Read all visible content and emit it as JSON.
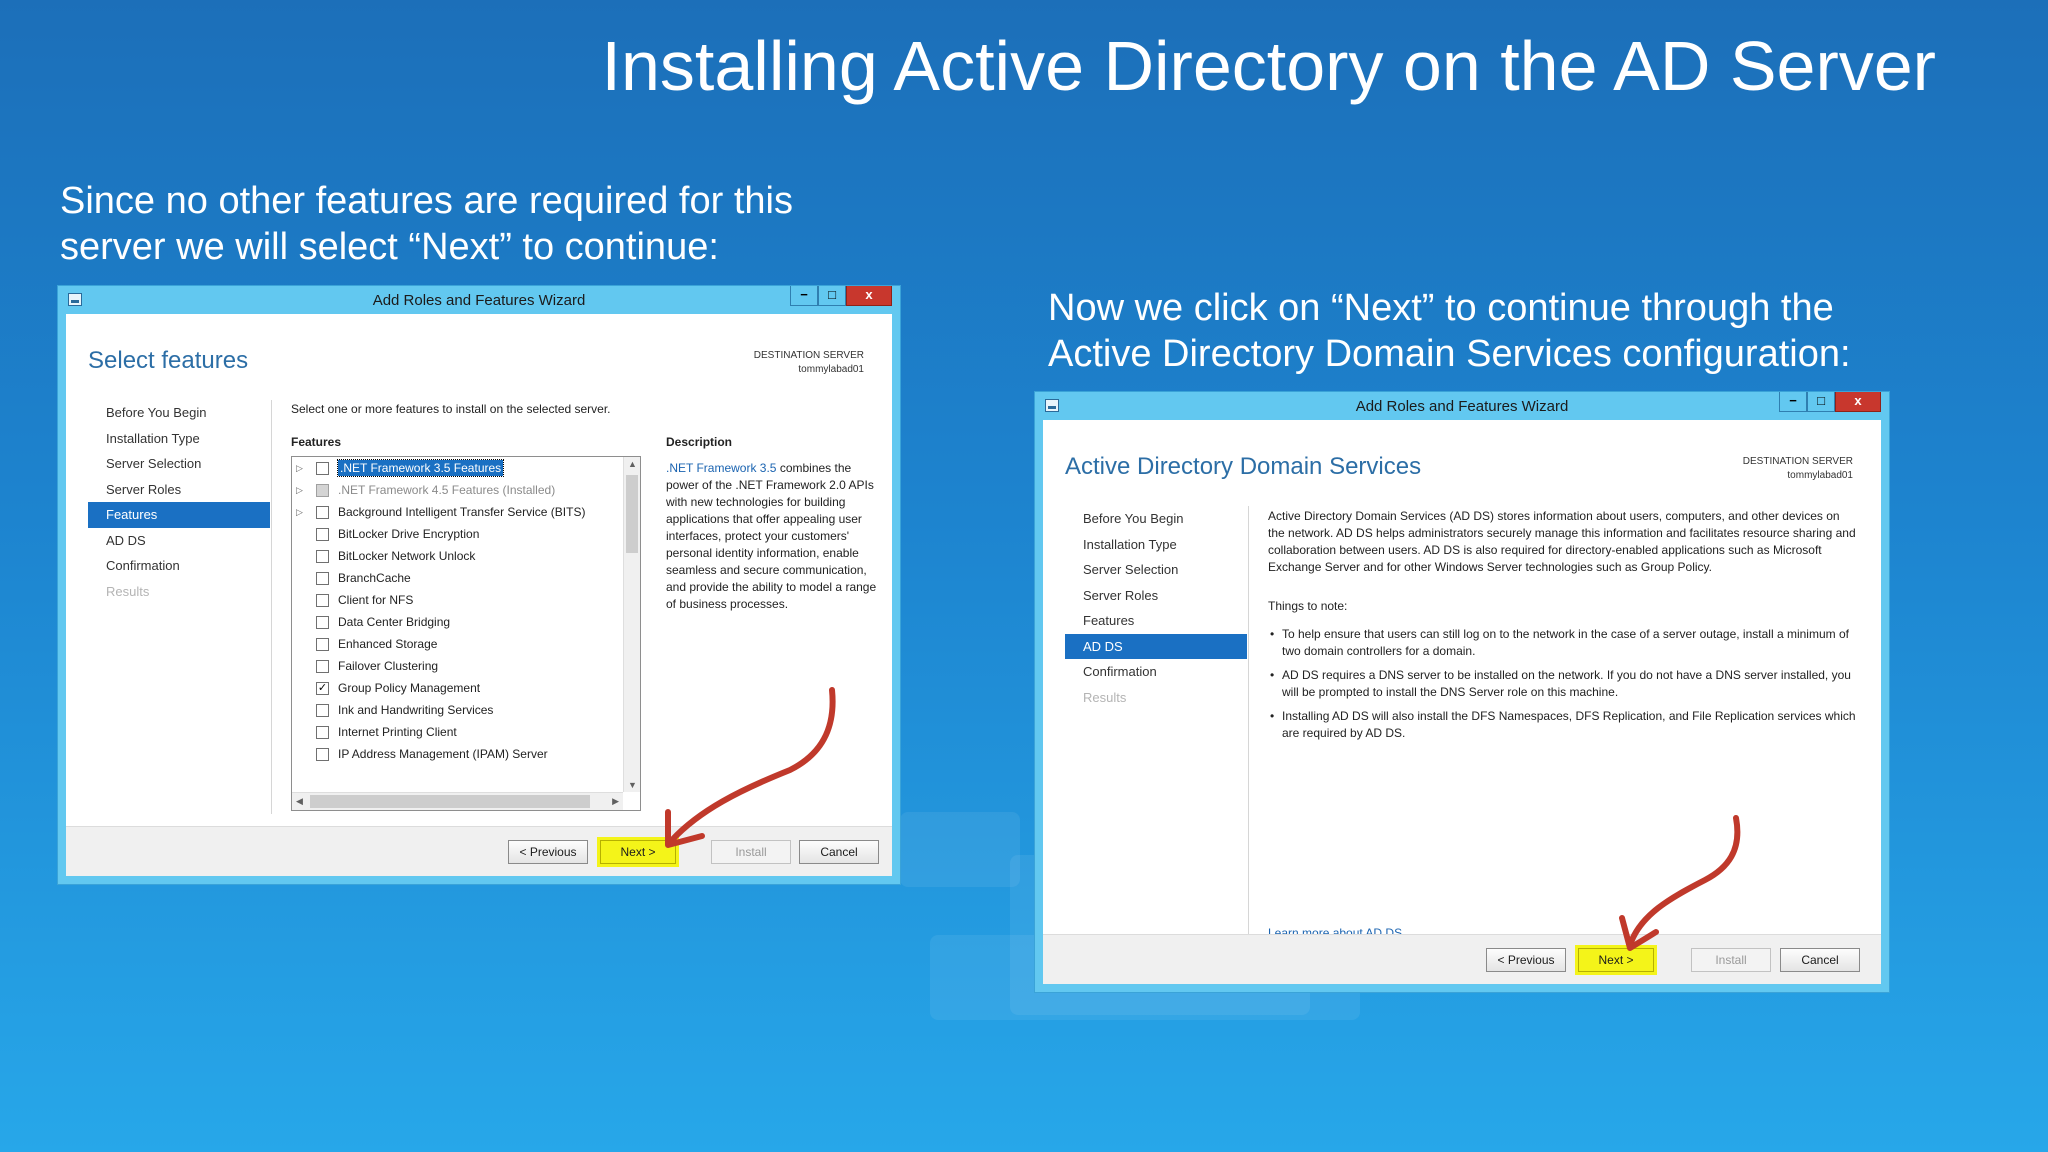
{
  "slide": {
    "title": "Installing Active Directory on the AD Server",
    "caption_left": [
      "Since no other features are required for this",
      "server we will select “Next” to continue:"
    ],
    "caption_right": [
      "Now we click on “Next” to continue through the",
      "Active Directory Domain Services configuration:"
    ]
  },
  "window_left": {
    "title": "Add Roles and Features Wizard",
    "controls": {
      "minimize": "−",
      "maximize": "□",
      "close": "x"
    },
    "heading": "Select features",
    "destination_label": "DESTINATION SERVER",
    "destination_server": "tommylabad01",
    "nav": [
      {
        "label": "Before You Begin",
        "state": "normal"
      },
      {
        "label": "Installation Type",
        "state": "normal"
      },
      {
        "label": "Server Selection",
        "state": "normal"
      },
      {
        "label": "Server Roles",
        "state": "normal"
      },
      {
        "label": "Features",
        "state": "active"
      },
      {
        "label": "AD DS",
        "state": "normal"
      },
      {
        "label": "Confirmation",
        "state": "normal"
      },
      {
        "label": "Results",
        "state": "disabled"
      }
    ],
    "intro": "Select one or more features to install on the selected server.",
    "features_label": "Features",
    "features": [
      {
        "label": ".NET Framework 3.5 Features",
        "expander": true,
        "checked": false,
        "selected": true
      },
      {
        "label": ".NET Framework 4.5 Features (Installed)",
        "expander": true,
        "checked": false,
        "installed": true
      },
      {
        "label": "Background Intelligent Transfer Service (BITS)",
        "expander": true,
        "checked": false
      },
      {
        "label": "BitLocker Drive Encryption",
        "checked": false
      },
      {
        "label": "BitLocker Network Unlock",
        "checked": false
      },
      {
        "label": "BranchCache",
        "checked": false
      },
      {
        "label": "Client for NFS",
        "checked": false
      },
      {
        "label": "Data Center Bridging",
        "checked": false
      },
      {
        "label": "Enhanced Storage",
        "checked": false
      },
      {
        "label": "Failover Clustering",
        "checked": false
      },
      {
        "label": "Group Policy Management",
        "checked": true
      },
      {
        "label": "Ink and Handwriting Services",
        "checked": false
      },
      {
        "label": "Internet Printing Client",
        "checked": false
      },
      {
        "label": "IP Address Management (IPAM) Server",
        "checked": false
      }
    ],
    "description_label": "Description",
    "description_link": ".NET Framework 3.5",
    "description_text": " combines the power of the .NET Framework 2.0 APIs with new technologies for building applications that offer appealing user interfaces, protect your customers' personal identity information, enable seamless and secure communication, and provide the ability to model a range of business processes.",
    "buttons": {
      "previous": "< Previous",
      "next": "Next >",
      "install": "Install",
      "cancel": "Cancel"
    }
  },
  "window_right": {
    "title": "Add Roles and Features Wizard",
    "controls": {
      "minimize": "−",
      "maximize": "□",
      "close": "x"
    },
    "heading": "Active Directory Domain Services",
    "destination_label": "DESTINATION SERVER",
    "destination_server": "tommylabad01",
    "nav": [
      {
        "label": "Before You Begin",
        "state": "normal"
      },
      {
        "label": "Installation Type",
        "state": "normal"
      },
      {
        "label": "Server Selection",
        "state": "normal"
      },
      {
        "label": "Server Roles",
        "state": "normal"
      },
      {
        "label": "Features",
        "state": "normal"
      },
      {
        "label": "AD DS",
        "state": "active"
      },
      {
        "label": "Confirmation",
        "state": "normal"
      },
      {
        "label": "Results",
        "state": "disabled"
      }
    ],
    "intro": "Active Directory Domain Services (AD DS) stores information about users, computers, and other devices on the network.  AD DS helps administrators securely manage this information and facilitates resource sharing and collaboration between users.  AD DS is also required for directory-enabled applications such as Microsoft Exchange Server and for other Windows Server technologies such as Group Policy.",
    "things_label": "Things to note:",
    "notes": [
      "To help ensure that users can still log on to the network in the case of a server outage, install a minimum of two domain controllers for a domain.",
      "AD DS requires a DNS server to be installed on the network.  If you do not have a DNS server installed, you will be prompted to install the DNS Server role on this machine.",
      "Installing AD DS will also install the DFS Namespaces, DFS Replication, and File Replication services which are required by AD DS."
    ],
    "learn_more": "Learn more about AD DS",
    "buttons": {
      "previous": "< Previous",
      "next": "Next >",
      "install": "Install",
      "cancel": "Cancel"
    }
  },
  "colors": {
    "annotation_arrow": "#c0392b",
    "highlight": "#f4f419",
    "selection": "#1a70c3"
  }
}
